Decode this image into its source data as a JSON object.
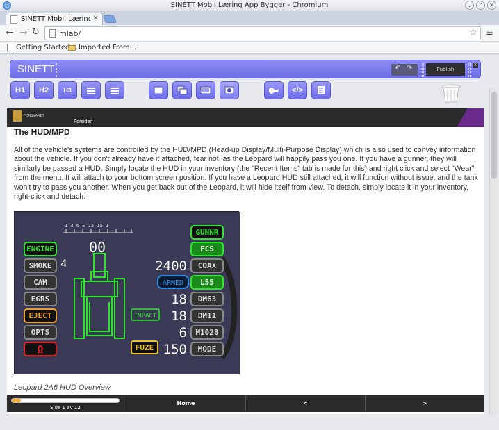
{
  "window": {
    "title": "SINETT Mobil Læring App Bygger - Chromium"
  },
  "tab": {
    "label": "SINETT Mobil Læring App"
  },
  "address": {
    "url": "mlab/"
  },
  "bookmarks": {
    "items": [
      "Getting Started",
      "Imported From..."
    ]
  },
  "editor": {
    "brand": "SINETT",
    "publish_label": "Publish",
    "toolbar": [
      "H1",
      "H2",
      "H3"
    ]
  },
  "page": {
    "org": "FORSVARET",
    "home_link": "Forsiden",
    "title": "The HUD/MPD",
    "paragraph": "All of the vehicle's systems are controlled by the HUD/MPD (Head-up Display/Multi-Purpose Display) which is also used to convey information about the vehicle. If you don't already have it attached, fear not, as the Leopard will happily pass you one. If you have a gunner, they will similarly be passed a HUD. Simply locate the HUD in your inventory (the \"Recent Items\" tab is made for this) and right click and select \"Wear\" from the menu. It will attach to your bottom screen position. If you have a Leopard HUD still attached, it will function without issue, and the tank won't try to pass you another.  When you get back out of the Leopard, it will hide itself from view. To detach, simply locate it in your inventory, right-click and detach.",
    "caption": "Leopard 2A6 HUD Overview"
  },
  "hud": {
    "left_buttons": [
      "ENGINE",
      "SMOKE",
      "CAM",
      "EGRS",
      "EJECT",
      "OPTS"
    ],
    "right_buttons": [
      "GUNNR",
      "FCS",
      "COAX",
      "L55",
      "DM63",
      "DM11",
      "M1028",
      "MODE"
    ],
    "readouts": [
      "2400",
      "18",
      "18",
      "6",
      "150"
    ],
    "center_value": "00",
    "side_value": "4",
    "armed": "ARMED",
    "impact": "IMPACT",
    "fuze": "FUZE",
    "compass": "1 3 6 E 12 15 1",
    "omega": "Ω"
  },
  "footer": {
    "progress": 0.083,
    "page_label": "Side 1 av 12",
    "home": "Home",
    "prev": "<",
    "next": ">"
  }
}
